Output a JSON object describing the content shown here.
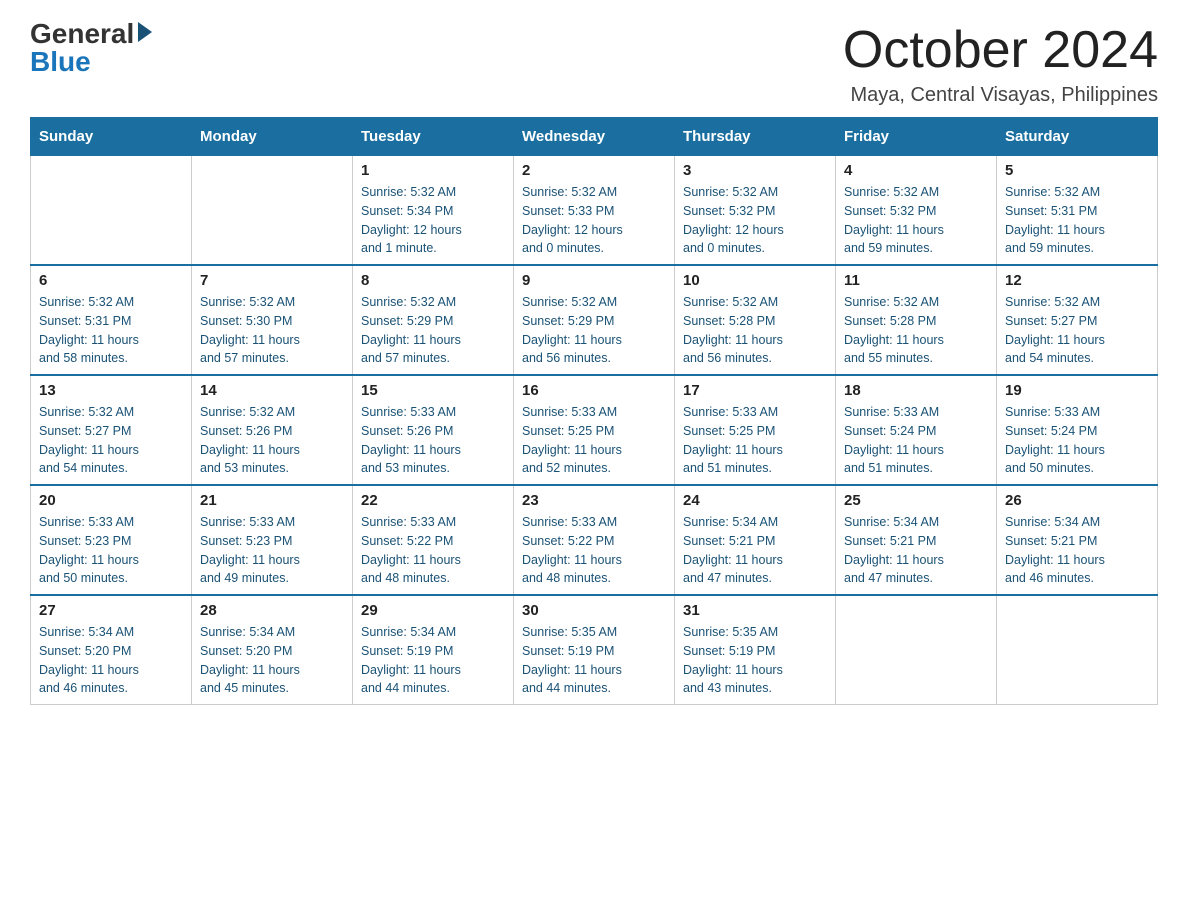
{
  "logo": {
    "general": "General",
    "blue": "Blue"
  },
  "header": {
    "title": "October 2024",
    "subtitle": "Maya, Central Visayas, Philippines"
  },
  "days": {
    "headers": [
      "Sunday",
      "Monday",
      "Tuesday",
      "Wednesday",
      "Thursday",
      "Friday",
      "Saturday"
    ]
  },
  "weeks": [
    {
      "days": [
        {
          "num": "",
          "info": ""
        },
        {
          "num": "",
          "info": ""
        },
        {
          "num": "1",
          "info": "Sunrise: 5:32 AM\nSunset: 5:34 PM\nDaylight: 12 hours\nand 1 minute."
        },
        {
          "num": "2",
          "info": "Sunrise: 5:32 AM\nSunset: 5:33 PM\nDaylight: 12 hours\nand 0 minutes."
        },
        {
          "num": "3",
          "info": "Sunrise: 5:32 AM\nSunset: 5:32 PM\nDaylight: 12 hours\nand 0 minutes."
        },
        {
          "num": "4",
          "info": "Sunrise: 5:32 AM\nSunset: 5:32 PM\nDaylight: 11 hours\nand 59 minutes."
        },
        {
          "num": "5",
          "info": "Sunrise: 5:32 AM\nSunset: 5:31 PM\nDaylight: 11 hours\nand 59 minutes."
        }
      ]
    },
    {
      "days": [
        {
          "num": "6",
          "info": "Sunrise: 5:32 AM\nSunset: 5:31 PM\nDaylight: 11 hours\nand 58 minutes."
        },
        {
          "num": "7",
          "info": "Sunrise: 5:32 AM\nSunset: 5:30 PM\nDaylight: 11 hours\nand 57 minutes."
        },
        {
          "num": "8",
          "info": "Sunrise: 5:32 AM\nSunset: 5:29 PM\nDaylight: 11 hours\nand 57 minutes."
        },
        {
          "num": "9",
          "info": "Sunrise: 5:32 AM\nSunset: 5:29 PM\nDaylight: 11 hours\nand 56 minutes."
        },
        {
          "num": "10",
          "info": "Sunrise: 5:32 AM\nSunset: 5:28 PM\nDaylight: 11 hours\nand 56 minutes."
        },
        {
          "num": "11",
          "info": "Sunrise: 5:32 AM\nSunset: 5:28 PM\nDaylight: 11 hours\nand 55 minutes."
        },
        {
          "num": "12",
          "info": "Sunrise: 5:32 AM\nSunset: 5:27 PM\nDaylight: 11 hours\nand 54 minutes."
        }
      ]
    },
    {
      "days": [
        {
          "num": "13",
          "info": "Sunrise: 5:32 AM\nSunset: 5:27 PM\nDaylight: 11 hours\nand 54 minutes."
        },
        {
          "num": "14",
          "info": "Sunrise: 5:32 AM\nSunset: 5:26 PM\nDaylight: 11 hours\nand 53 minutes."
        },
        {
          "num": "15",
          "info": "Sunrise: 5:33 AM\nSunset: 5:26 PM\nDaylight: 11 hours\nand 53 minutes."
        },
        {
          "num": "16",
          "info": "Sunrise: 5:33 AM\nSunset: 5:25 PM\nDaylight: 11 hours\nand 52 minutes."
        },
        {
          "num": "17",
          "info": "Sunrise: 5:33 AM\nSunset: 5:25 PM\nDaylight: 11 hours\nand 51 minutes."
        },
        {
          "num": "18",
          "info": "Sunrise: 5:33 AM\nSunset: 5:24 PM\nDaylight: 11 hours\nand 51 minutes."
        },
        {
          "num": "19",
          "info": "Sunrise: 5:33 AM\nSunset: 5:24 PM\nDaylight: 11 hours\nand 50 minutes."
        }
      ]
    },
    {
      "days": [
        {
          "num": "20",
          "info": "Sunrise: 5:33 AM\nSunset: 5:23 PM\nDaylight: 11 hours\nand 50 minutes."
        },
        {
          "num": "21",
          "info": "Sunrise: 5:33 AM\nSunset: 5:23 PM\nDaylight: 11 hours\nand 49 minutes."
        },
        {
          "num": "22",
          "info": "Sunrise: 5:33 AM\nSunset: 5:22 PM\nDaylight: 11 hours\nand 48 minutes."
        },
        {
          "num": "23",
          "info": "Sunrise: 5:33 AM\nSunset: 5:22 PM\nDaylight: 11 hours\nand 48 minutes."
        },
        {
          "num": "24",
          "info": "Sunrise: 5:34 AM\nSunset: 5:21 PM\nDaylight: 11 hours\nand 47 minutes."
        },
        {
          "num": "25",
          "info": "Sunrise: 5:34 AM\nSunset: 5:21 PM\nDaylight: 11 hours\nand 47 minutes."
        },
        {
          "num": "26",
          "info": "Sunrise: 5:34 AM\nSunset: 5:21 PM\nDaylight: 11 hours\nand 46 minutes."
        }
      ]
    },
    {
      "days": [
        {
          "num": "27",
          "info": "Sunrise: 5:34 AM\nSunset: 5:20 PM\nDaylight: 11 hours\nand 46 minutes."
        },
        {
          "num": "28",
          "info": "Sunrise: 5:34 AM\nSunset: 5:20 PM\nDaylight: 11 hours\nand 45 minutes."
        },
        {
          "num": "29",
          "info": "Sunrise: 5:34 AM\nSunset: 5:19 PM\nDaylight: 11 hours\nand 44 minutes."
        },
        {
          "num": "30",
          "info": "Sunrise: 5:35 AM\nSunset: 5:19 PM\nDaylight: 11 hours\nand 44 minutes."
        },
        {
          "num": "31",
          "info": "Sunrise: 5:35 AM\nSunset: 5:19 PM\nDaylight: 11 hours\nand 43 minutes."
        },
        {
          "num": "",
          "info": ""
        },
        {
          "num": "",
          "info": ""
        }
      ]
    }
  ]
}
